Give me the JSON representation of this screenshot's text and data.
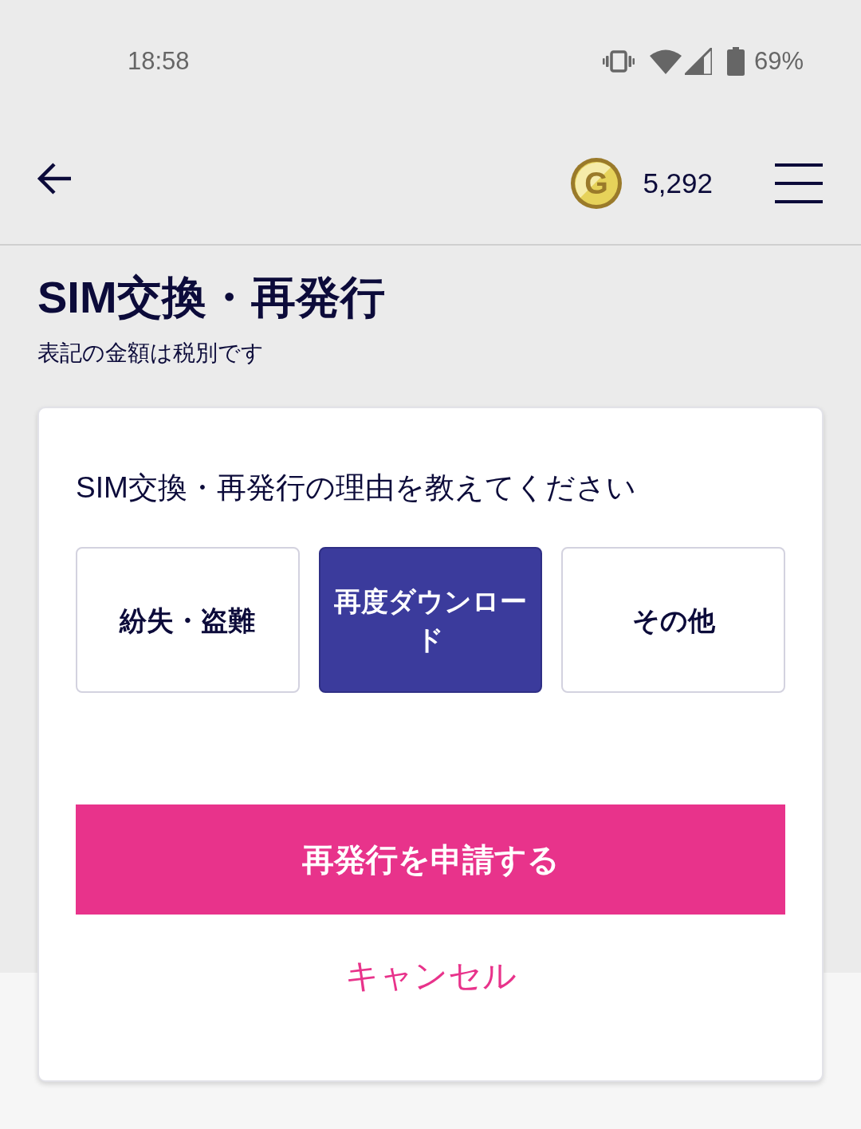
{
  "status_bar": {
    "time": "18:58",
    "battery": "69%"
  },
  "header": {
    "coin_letter": "G",
    "points": "5,292"
  },
  "page": {
    "title": "SIM交換・再発行",
    "note": "表記の金額は税別です"
  },
  "card": {
    "question": "SIM交換・再発行の理由を教えてください",
    "options": [
      {
        "label": "紛失・盗難",
        "selected": false
      },
      {
        "label": "再度ダウンロード",
        "selected": true
      },
      {
        "label": "その他",
        "selected": false
      }
    ],
    "submit_button": "再発行を申請する",
    "cancel_link": "キャンセル"
  }
}
